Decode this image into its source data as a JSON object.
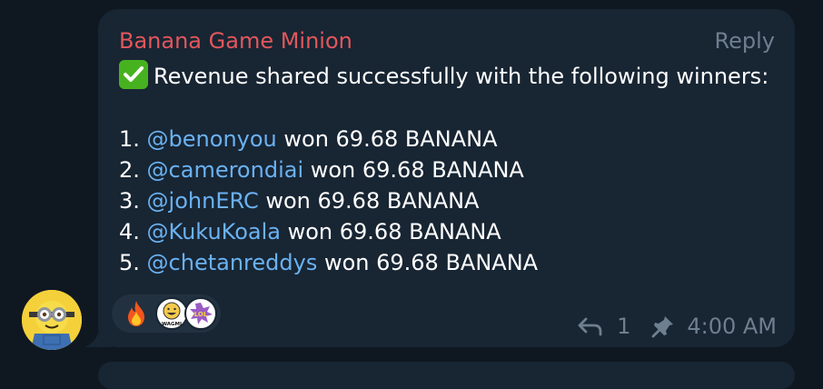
{
  "message": {
    "sender": "Banana Game Minion",
    "reply_label": "Reply",
    "headline": "Revenue shared successfully with the following winners:",
    "winners": [
      {
        "index": "1.",
        "handle": "@benonyou",
        "text": " won 69.68 BANANA"
      },
      {
        "index": "2.",
        "handle": "@camerondiai",
        "text": " won 69.68 BANANA"
      },
      {
        "index": "3.",
        "handle": "@johnERC",
        "text": " won 69.68 BANANA"
      },
      {
        "index": "4.",
        "handle": "@KukuKoala",
        "text": " won 69.68 BANANA"
      },
      {
        "index": "5.",
        "handle": "@chetanreddys",
        "text": " won 69.68 BANANA"
      }
    ],
    "reactions": [
      {
        "icon": "fire-icon"
      },
      {
        "icon": "wagmi-sticker-icon",
        "text": "WAGMI"
      },
      {
        "icon": "lol-sticker-icon",
        "text": "LOL"
      }
    ],
    "reply_count": "1",
    "time": "4:00 AM"
  },
  "colors": {
    "background": "#0f1821",
    "bubble": "#182533",
    "sender": "#e2575c",
    "mention": "#6ab2f2",
    "meta": "#6e7f8f"
  }
}
